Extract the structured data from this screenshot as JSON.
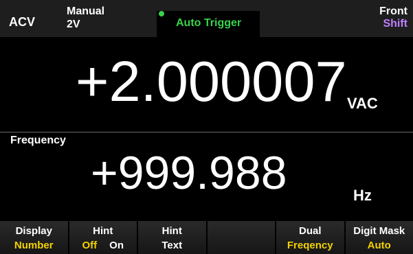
{
  "status_bar": {
    "function": "ACV",
    "range_mode": "Manual",
    "range_value": "2V",
    "trigger": "Auto Trigger",
    "terminal": "Front",
    "shift": "Shift"
  },
  "primary_display": {
    "value": "+2.000007",
    "unit": "VAC"
  },
  "secondary_display": {
    "label": "Frequency",
    "value": "+999.988",
    "unit": "Hz"
  },
  "softkeys": [
    {
      "label": "Display",
      "value": "Number"
    },
    {
      "label": "Hint",
      "options": [
        "Off",
        "On"
      ],
      "selected": "Off"
    },
    {
      "label": "Hint",
      "value": "Text"
    },
    {
      "label": "",
      "value": ""
    },
    {
      "label": "Dual",
      "value": "Freqency"
    },
    {
      "label": "Digit Mask",
      "value": "Auto"
    }
  ],
  "colors": {
    "trigger_indicator": "#39d24a",
    "shift": "#c080ff",
    "softkey_selected": "#f3d100",
    "background": "#000000",
    "bar_background": "#1e1e1e"
  }
}
